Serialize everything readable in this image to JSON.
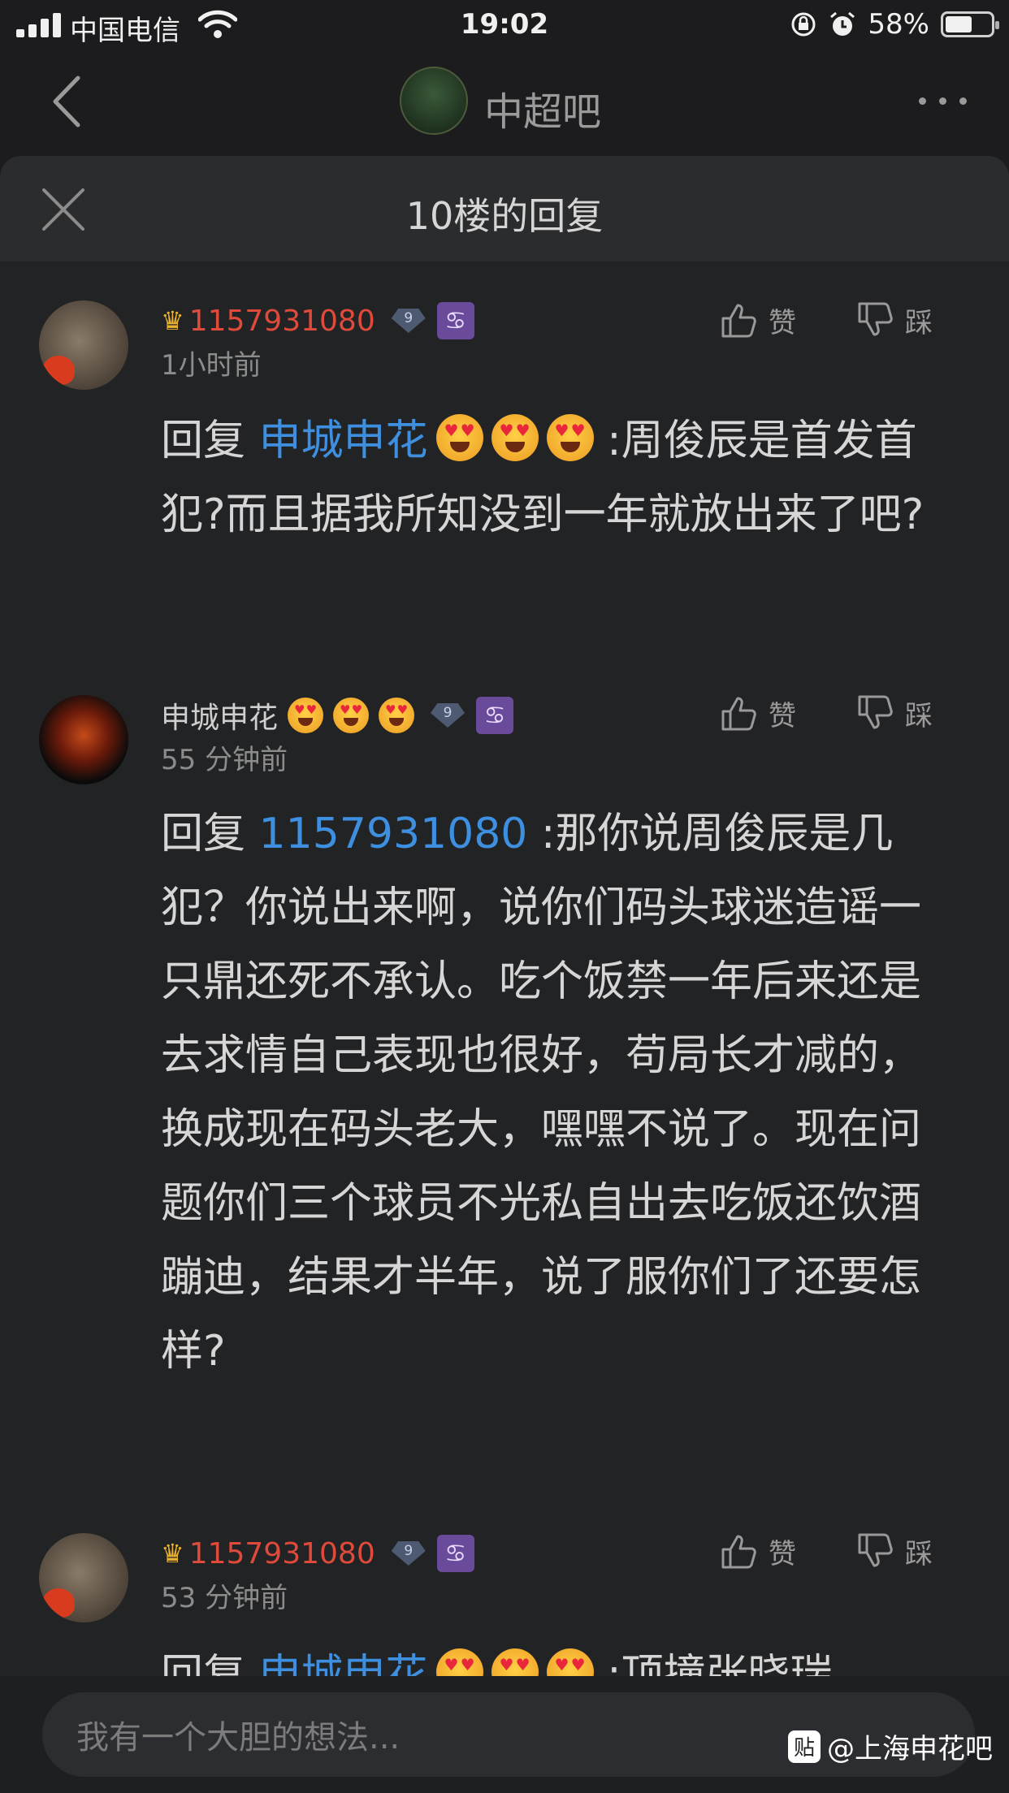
{
  "status_bar": {
    "carrier": "中国电信",
    "time": "19:02",
    "battery_percent": "58%"
  },
  "nav": {
    "forum_name": "中超吧"
  },
  "sheet": {
    "title": "10楼的回复"
  },
  "actions": {
    "like": "赞",
    "dislike": "踩"
  },
  "comments": [
    {
      "username": "1157931080",
      "level": "9",
      "zodiac": "♋",
      "time": "1小时前",
      "reply_prefix": "回复 ",
      "mention": "申城申花",
      "text_line1": " :周俊辰是首",
      "text_rest": "发首犯?而且据我所知没到一年就放出来了吧?"
    },
    {
      "username": "申城申花",
      "level": "9",
      "zodiac": "♋",
      "time": "55 分钟前",
      "reply_prefix": "回复 ",
      "mention": "1157931080",
      "text": " :那你说周俊辰是几犯？你说出来啊，说你们码头球迷造谣一只鼎还死不承认。吃个饭禁一年后来还是去求情自己表现也很好，苟局长才减的，换成现在码头老大，嘿嘿不说了。现在问题你们三个球员不光私自出去吃饭还饮酒蹦迪，结果才半年，说了服你们了还要怎样?"
    },
    {
      "username": "1157931080",
      "level": "9",
      "zodiac": "♋",
      "time": "53 分钟前",
      "reply_prefix": "回复 ",
      "mention": "申城申花",
      "text": " :顶撞张晓瑞"
    }
  ],
  "input": {
    "placeholder": "我有一个大胆的想法..."
  },
  "watermark": {
    "icon_text": "贴",
    "text": "@上海申花吧"
  }
}
